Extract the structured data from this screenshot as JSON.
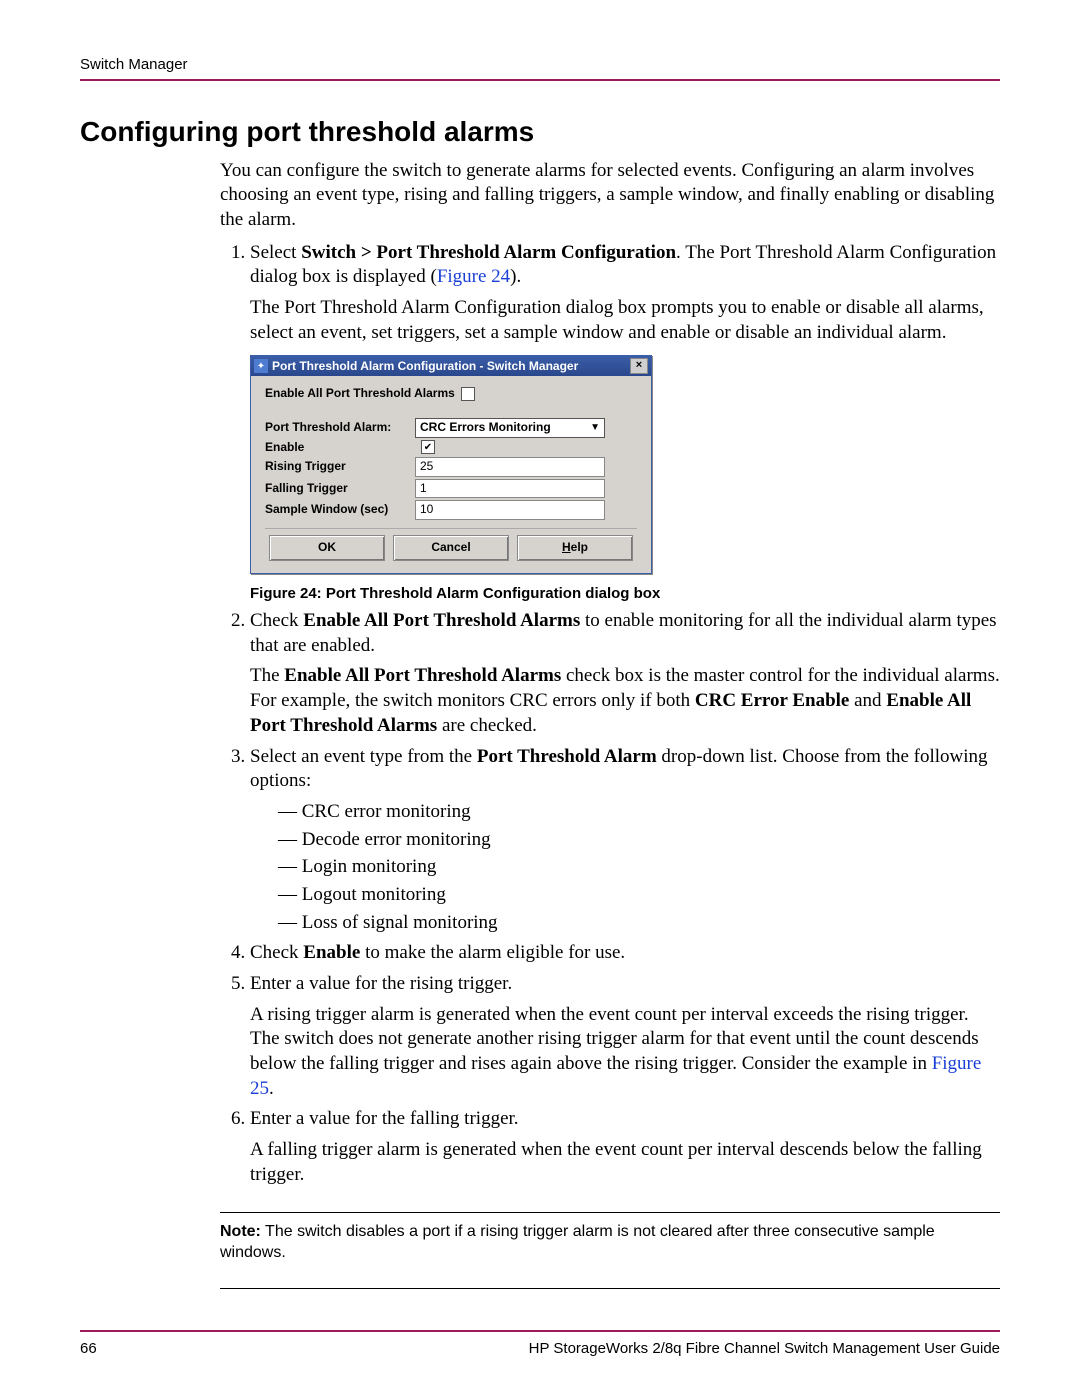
{
  "header": {
    "running_head": "Switch Manager"
  },
  "title": "Configuring port threshold alarms",
  "intro": "You can configure the switch to generate alarms for selected events. Configuring an alarm involves choosing an event type, rising and falling triggers, a sample window, and finally enabling or disabling the alarm.",
  "steps": {
    "s1_a": "Select ",
    "s1_b": "Switch > Port Threshold Alarm Configuration",
    "s1_c": ". The Port Threshold Alarm Configuration dialog box is displayed (",
    "s1_link": "Figure 24",
    "s1_d": ").",
    "s1_after": "The Port Threshold Alarm Configuration dialog box prompts you to enable or disable all alarms, select an event, set triggers, set a sample window and enable or disable an individual alarm.",
    "s2_a": "Check ",
    "s2_b": "Enable All Port Threshold Alarms",
    "s2_c": " to enable monitoring for all the individual alarm types that are enabled.",
    "s2_after_a": "The ",
    "s2_after_b": "Enable All Port Threshold Alarms",
    "s2_after_c": " check box is the master control for the individual alarms. For example, the switch monitors CRC errors only if both ",
    "s2_after_d": "CRC Error Enable",
    "s2_after_e": " and ",
    "s2_after_f": "Enable All Port Threshold Alarms",
    "s2_after_g": " are checked.",
    "s3_a": "Select an event type from the ",
    "s3_b": "Port Threshold Alarm",
    "s3_c": " drop-down list. Choose from the following options:",
    "s3_opts": [
      "CRC error monitoring",
      "Decode error monitoring",
      "Login monitoring",
      "Logout monitoring",
      "Loss of signal monitoring"
    ],
    "s4_a": "Check ",
    "s4_b": "Enable",
    "s4_c": " to make the alarm eligible for use.",
    "s5": "Enter a value for the rising trigger.",
    "s5_after_a": "A rising trigger alarm is generated when the event count per interval exceeds the rising trigger. The switch does not generate another rising trigger alarm for that event until the count descends below the falling trigger and rises again above the rising trigger. Consider the example in ",
    "s5_after_link": "Figure 25",
    "s5_after_b": ".",
    "s6": "Enter a value for the falling trigger.",
    "s6_after": "A falling trigger alarm is generated when the event count per interval descends below the falling trigger."
  },
  "caption": "Figure 24:  Port Threshold Alarm Configuration dialog box",
  "note": {
    "label": "Note:",
    "text": "  The switch disables a port if a rising trigger alarm is not cleared after three consecutive sample windows."
  },
  "footer": {
    "page": "66",
    "doc": "HP StorageWorks 2/8q Fibre Channel Switch Management User Guide"
  },
  "dialog": {
    "title": "Port Threshold Alarm Configuration - Switch Manager",
    "enable_all_label": "Enable All Port Threshold Alarms",
    "labels": {
      "alarm": "Port Threshold Alarm:",
      "enable": "Enable",
      "rising": "Rising Trigger",
      "falling": "Falling Trigger",
      "window": "Sample Window (sec)"
    },
    "values": {
      "alarm_selected": "CRC Errors Monitoring",
      "rising": "25",
      "falling": "1",
      "window": "10"
    },
    "buttons": {
      "ok": "OK",
      "cancel": "Cancel",
      "help_pre": "H",
      "help_rest": "elp"
    }
  }
}
